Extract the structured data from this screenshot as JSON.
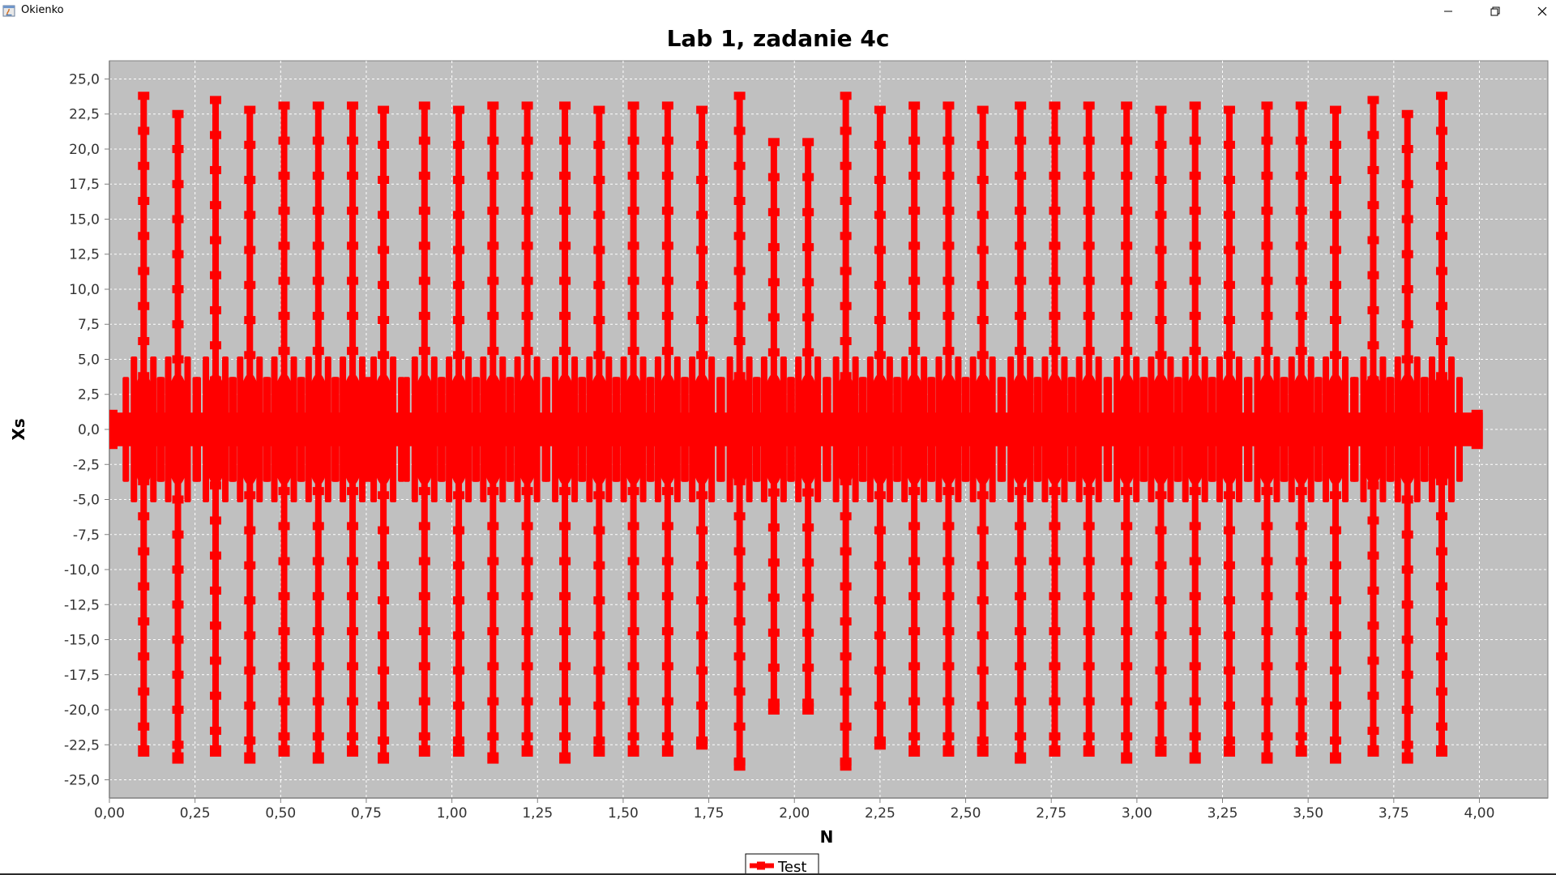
{
  "window": {
    "title": "Okienko",
    "icons": {
      "app": "java-app-icon",
      "minimize": "minimize-icon",
      "maximize": "restore-icon",
      "close": "close-icon"
    }
  },
  "chart_data": {
    "type": "line",
    "title": "Lab 1, zadanie 4c",
    "xlabel": "N",
    "ylabel": "Xs",
    "xlim": [
      0,
      4.2
    ],
    "ylim": [
      -26.3,
      26.3
    ],
    "x_ticks": [
      "0,00",
      "0,25",
      "0,50",
      "0,75",
      "1,00",
      "1,25",
      "1,50",
      "1,75",
      "2,00",
      "2,25",
      "2,50",
      "2,75",
      "3,00",
      "3,25",
      "3,50",
      "3,75",
      "4,00"
    ],
    "y_ticks": [
      "25,0",
      "22,5",
      "20,0",
      "17,5",
      "15,0",
      "12,5",
      "10,0",
      "7,5",
      "5,0",
      "2,5",
      "0,0",
      "-2,5",
      "-5,0",
      "-7,5",
      "-10,0",
      "-12,5",
      "-15,0",
      "-17,5",
      "-20,0",
      "-22,5",
      "-25,0"
    ],
    "grid": true,
    "background": "#c0c0c0",
    "series": [
      {
        "name": "Test",
        "color": "#ff0000",
        "x_range": [
          0,
          4.01
        ],
        "marker": "square",
        "spikes": [
          {
            "x": 0.1,
            "max": 23.8,
            "min": -23.0
          },
          {
            "x": 0.2,
            "max": 22.5,
            "min": -23.5
          },
          {
            "x": 0.31,
            "max": 23.5,
            "min": -23.0
          },
          {
            "x": 0.41,
            "max": 22.8,
            "min": -23.5
          },
          {
            "x": 0.51,
            "max": 23.1,
            "min": -23.0
          },
          {
            "x": 0.61,
            "max": 23.1,
            "min": -23.5
          },
          {
            "x": 0.71,
            "max": 23.1,
            "min": -23.0
          },
          {
            "x": 0.8,
            "max": 22.8,
            "min": -23.5
          },
          {
            "x": 0.92,
            "max": 23.1,
            "min": -23.0
          },
          {
            "x": 1.02,
            "max": 22.8,
            "min": -23.0
          },
          {
            "x": 1.12,
            "max": 23.1,
            "min": -23.5
          },
          {
            "x": 1.22,
            "max": 23.1,
            "min": -23.0
          },
          {
            "x": 1.33,
            "max": 23.1,
            "min": -23.5
          },
          {
            "x": 1.43,
            "max": 22.8,
            "min": -23.0
          },
          {
            "x": 1.53,
            "max": 23.1,
            "min": -23.0
          },
          {
            "x": 1.63,
            "max": 23.1,
            "min": -23.0
          },
          {
            "x": 1.73,
            "max": 22.8,
            "min": -22.5
          },
          {
            "x": 1.84,
            "max": 23.8,
            "min": -24.0
          },
          {
            "x": 1.94,
            "max": 20.5,
            "min": -20.0
          },
          {
            "x": 2.04,
            "max": 20.5,
            "min": -20.0
          },
          {
            "x": 2.15,
            "max": 23.8,
            "min": -24.0
          },
          {
            "x": 2.25,
            "max": 22.8,
            "min": -22.5
          },
          {
            "x": 2.35,
            "max": 23.1,
            "min": -23.0
          },
          {
            "x": 2.45,
            "max": 23.1,
            "min": -23.0
          },
          {
            "x": 2.55,
            "max": 22.8,
            "min": -23.0
          },
          {
            "x": 2.66,
            "max": 23.1,
            "min": -23.5
          },
          {
            "x": 2.76,
            "max": 23.1,
            "min": -23.0
          },
          {
            "x": 2.86,
            "max": 23.1,
            "min": -23.0
          },
          {
            "x": 2.97,
            "max": 23.1,
            "min": -23.5
          },
          {
            "x": 3.07,
            "max": 22.8,
            "min": -23.0
          },
          {
            "x": 3.17,
            "max": 23.1,
            "min": -23.5
          },
          {
            "x": 3.27,
            "max": 22.8,
            "min": -23.0
          },
          {
            "x": 3.38,
            "max": 23.1,
            "min": -23.5
          },
          {
            "x": 3.48,
            "max": 23.1,
            "min": -23.0
          },
          {
            "x": 3.58,
            "max": 22.8,
            "min": -23.5
          },
          {
            "x": 3.69,
            "max": 23.5,
            "min": -23.0
          },
          {
            "x": 3.79,
            "max": 22.5,
            "min": -23.5
          },
          {
            "x": 3.89,
            "max": 23.8,
            "min": -23.0
          }
        ],
        "ripple_amplitude": 5.2,
        "baseline_amplitude": 1.2
      }
    ],
    "legend": {
      "position": "bottom-center",
      "label": "Test"
    }
  }
}
